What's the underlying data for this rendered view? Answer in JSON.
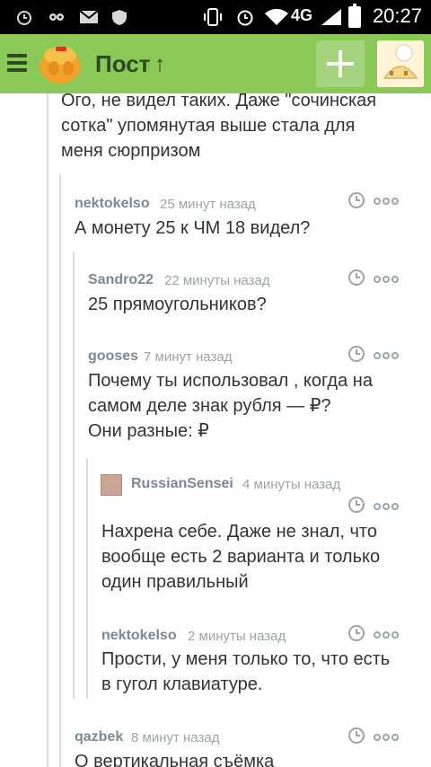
{
  "status_bar": {
    "time": "20:27",
    "network": "4G",
    "icons": [
      "alarm-icon",
      "owl-icon",
      "mail-icon",
      "shield-icon",
      "vibrate-icon",
      "alarm-icon",
      "wifi-icon",
      "signal-icon",
      "battery-icon"
    ]
  },
  "app_bar": {
    "title": "Пост",
    "up_icon": "↑",
    "add_icon": "plus-icon",
    "background": "#8ac858"
  },
  "comments": [
    {
      "text_lines": [
        "Ого, не видел таких. Даже \"сочинская",
        "сотка\" упомянутая выше стала для",
        "меня сюрпризом"
      ]
    },
    {
      "author": "nektokelso",
      "time": "25 минут назад",
      "text_lines": [
        "А монету 25   к ЧМ 18 видел?"
      ]
    },
    {
      "author": "Sandro22",
      "time": "22 минуты назад",
      "text_lines": [
        "25 прямоугольников?"
      ]
    },
    {
      "author": "gooses",
      "time": "7 минут назад",
      "text_lines": [
        "Почему ты использовал  , когда на",
        "самом деле знак рубля — ₽?",
        "Они разные:   ₽"
      ]
    },
    {
      "author": "RussianSensei",
      "time": "4 минуты назад",
      "text_lines": [
        "Нахрена себе. Даже не знал, что",
        "вообще есть 2 варианта и только",
        "один правильный"
      ]
    },
    {
      "author": "nektokelso",
      "time": "2 минуты назад",
      "text_lines": [
        "Прости, у меня только то, что есть",
        "в гугол клавиатуре."
      ]
    },
    {
      "author": "qazbek",
      "time": "8 минут назад",
      "text_lines": [
        "О вертикальная съёмка"
      ]
    }
  ]
}
